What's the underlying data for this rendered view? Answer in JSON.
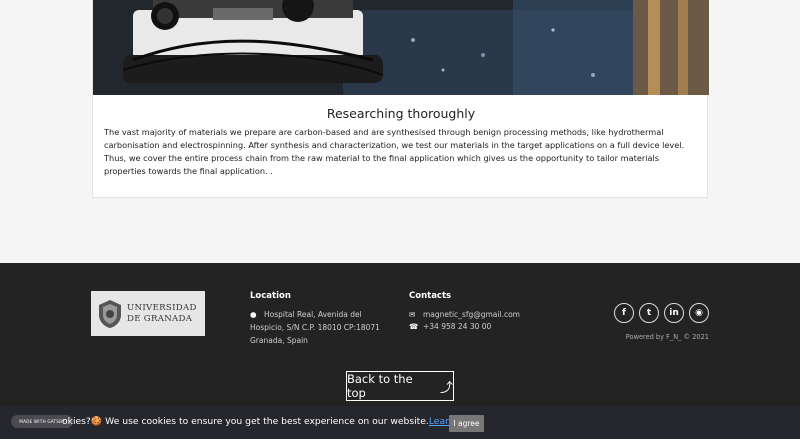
{
  "card": {
    "title": "Researching thoroughly",
    "body": "The vast majority of materials we prepare are carbon-based and are synthesised through benign processing methods, like hydrothermal carbonisation and electrospinning. After synthesis and characterization, we test our materials in the target applications on a full device level. Thus, we cover the entire process chain from the raw material to the final application which gives us the opportunity to tailor materials properties towards the final application. ."
  },
  "footer": {
    "logo_line1": "UNIVERSIDAD",
    "logo_line2": "DE GRANADA",
    "location": {
      "heading": "Location",
      "line1": "Hospital Real, Avenida del",
      "line2": "Hospicio, S/N C.P. 18010 CP:18071",
      "line3": "Granada, Spain"
    },
    "contacts": {
      "heading": "Contacts",
      "email": "magnetic_sfg@gmail.com",
      "phone": "+34 958 24 30 00"
    },
    "powered_by": "Powered by F_N_ © 2021",
    "back_to_top": "Back to the top"
  },
  "cookie": {
    "badge": "MADE WITH GATSBY",
    "text": "okies?🍪 We use cookies to ensure you get the best experience on our website.",
    "link": "Learn more",
    "agree": "I agree"
  },
  "icons": {
    "social": [
      "facebook-icon",
      "twitter-icon",
      "linkedin-icon",
      "instagram-icon"
    ],
    "accent": "#232323"
  }
}
